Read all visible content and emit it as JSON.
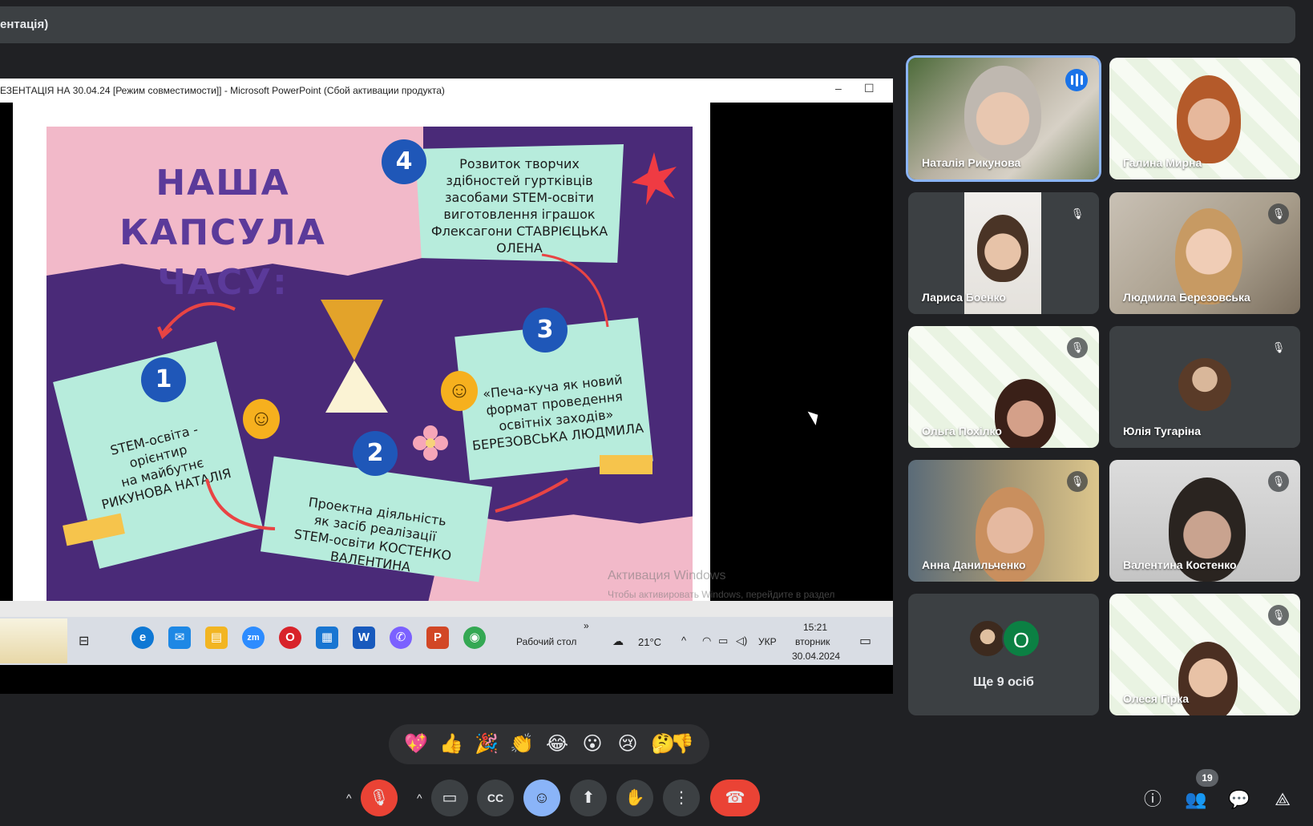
{
  "meeting": {
    "title_fragment": "ентація)"
  },
  "powerpoint": {
    "window_title": "ЕЗЕНТАЦІЯ НА 30.04.24 [Режим совместимости]] - Microsoft PowerPoint (Сбой активации продукта)",
    "minimize_icon": "–",
    "maximize_icon": "☐"
  },
  "slide": {
    "title_line1": "НАША КАПСУЛА",
    "title_line2": "ЧАСУ:",
    "step1": {
      "num": "1",
      "lines": [
        "STEM-освіта -",
        "орієнтир",
        "на майбутнє",
        "РИКУНОВА НАТАЛІЯ"
      ]
    },
    "step2": {
      "num": "2",
      "lines": [
        "Проектна діяльність",
        "як засіб реалізації",
        "STEM-освіти КОСТЕНКО",
        "ВАЛЕНТИНА"
      ]
    },
    "step3": {
      "num": "3",
      "lines": [
        "«Печа-куча як новий",
        "формат проведення",
        "освітніх заходів»",
        "БЕРЕЗОВСЬКА ЛЮДМИЛА"
      ]
    },
    "step4": {
      "num": "4",
      "lines": [
        "Розвиток творчих",
        "здібностей гуртківців",
        "засобами STEM-освіти",
        "виготовлення іграшок",
        "Флексагони СТАВРІЄЦЬКА",
        "ОЛЕНА"
      ]
    }
  },
  "windows": {
    "watermark_title": "Активация Windows",
    "watermark_text": "Чтобы активировать Windows, перейдите в раздел \"Параметры\".",
    "taskbar_desktop": "Рабочий стол",
    "taskbar_chevron": "»",
    "temperature": "21°C",
    "language": "УКР",
    "time": "15:21",
    "weekday": "вторник",
    "date": "30.04.2024",
    "zoom_label": "zm",
    "word_label": "W",
    "ppt_label": "P"
  },
  "participants": [
    {
      "name": "Наталія Рикунова",
      "speaking": true
    },
    {
      "name": "Галина Мирна"
    },
    {
      "name": "Лариса Боенко",
      "muted": true
    },
    {
      "name": "Людмила Березовська",
      "muted": true
    },
    {
      "name": "Ольга Похілко",
      "muted": true
    },
    {
      "name": "Юлія Тугаріна",
      "muted": true
    },
    {
      "name": "Анна Данильченко",
      "muted": true
    },
    {
      "name": "Валентина Костенко",
      "muted": true
    },
    {
      "name": "Олеся Гірка",
      "muted": true
    }
  ],
  "others": {
    "label": "Ще 9 осіб",
    "initial": "О"
  },
  "reactions": [
    "💖",
    "👍",
    "🎉",
    "👏",
    "😂",
    "😮",
    "😢",
    "🤔",
    "👎"
  ],
  "controls": {
    "caret": "^",
    "mic": "🎙",
    "camera": "▭",
    "captions": "CC",
    "emoji": "☺",
    "present": "⬆",
    "hand": "✋",
    "more": "⋮",
    "hangup": "☎",
    "info": "ⓘ",
    "people": "👥",
    "chat": "💬",
    "activities": "⟁",
    "participant_count": "19"
  },
  "colors": {
    "bg": "#202124",
    "tile": "#3c4043",
    "active_outline": "#8ab4f8",
    "hangup": "#ea4335",
    "slide_purple": "#4a2a78",
    "slide_pink": "#f2b9c9",
    "paper_mint": "#b7ecdc",
    "number_blue": "#1f57b8"
  }
}
